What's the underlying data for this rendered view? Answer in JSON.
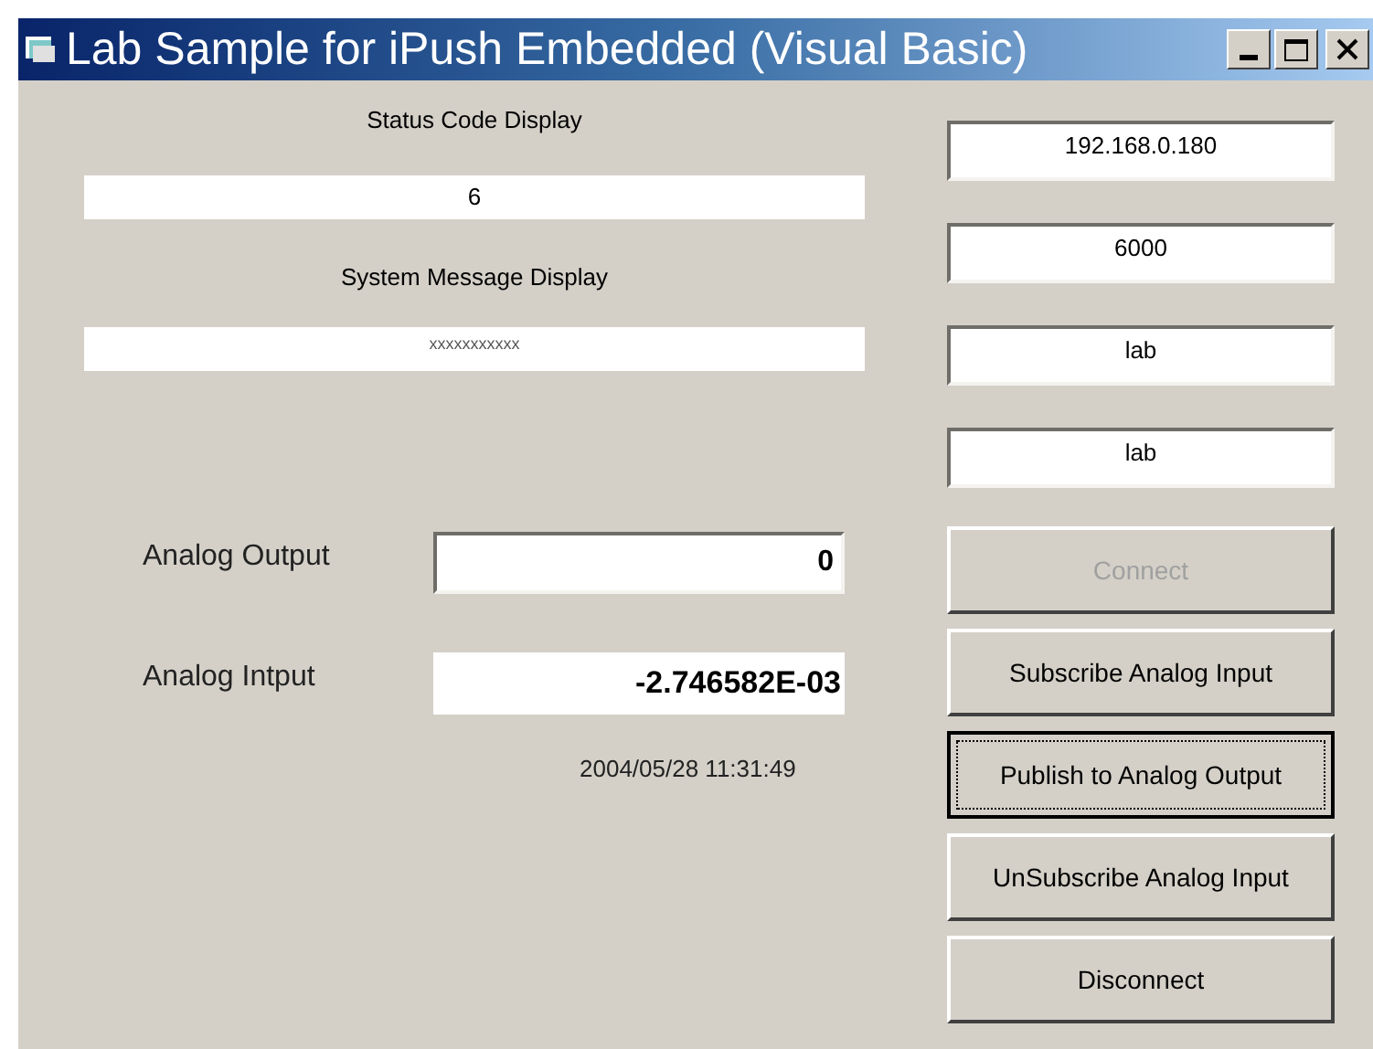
{
  "window": {
    "title": "Lab Sample for iPush Embedded (Visual Basic)"
  },
  "status": {
    "label": "Status Code Display",
    "value": "6"
  },
  "message": {
    "label": "System Message Display",
    "value": "xxxxxxxxxxx"
  },
  "analog": [
    {
      "label": "Analog Output",
      "value": "0",
      "kind": "textbox"
    },
    {
      "label": "Analog Intput",
      "value": "-2.746582E-03",
      "kind": "display"
    }
  ],
  "timestamp": "2004/05/28 11:31:49",
  "connection_fields": [
    {
      "value": "192.168.0.180"
    },
    {
      "value": "6000"
    },
    {
      "value": "lab"
    },
    {
      "value": "lab"
    }
  ],
  "buttons": [
    {
      "label": "Connect",
      "disabled": true,
      "focused": false
    },
    {
      "label": "Subscribe Analog Input",
      "disabled": false,
      "focused": false
    },
    {
      "label": "Publish to Analog Output",
      "disabled": false,
      "focused": true
    },
    {
      "label": "UnSubscribe Analog Input",
      "disabled": false,
      "focused": false
    },
    {
      "label": "Disconnect",
      "disabled": false,
      "focused": false
    }
  ]
}
